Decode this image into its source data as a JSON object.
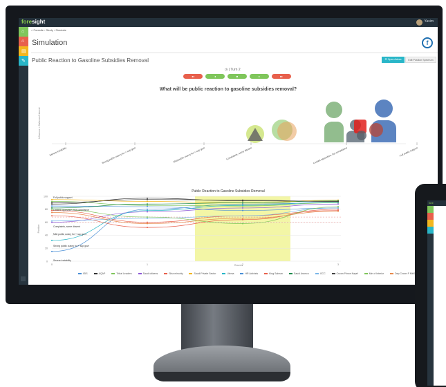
{
  "app": {
    "brand_a": "fore",
    "brand_b": "sight",
    "user_name": "Yasim"
  },
  "breadcrumb": "⌂  Foresite  ›  Study  ›  Simulate",
  "page_title": "Simulation",
  "logo_letter": "f",
  "subtitle": "Public Reaction to Gasoline Subsidies Removal",
  "buttons": {
    "open_actors": "☰ Open Actors",
    "edit_spectrum": "Edit Position Spectrum"
  },
  "turn_label": "◷ | Turn 2",
  "turn_buttons": [
    {
      "label": "◂◂",
      "color": "#e8604c"
    },
    {
      "label": "◂",
      "color": "#7fc65b"
    },
    {
      "label": "■",
      "color": "#7fc65b"
    },
    {
      "label": "▸",
      "color": "#7fc65b"
    },
    {
      "label": "▸▸",
      "color": "#e8604c"
    }
  ],
  "question": "What will be public reaction to gasoline subsidies removal?",
  "spectrum_axis_label": "Influence × Salience/Interest",
  "spectrum_categories": [
    "Severe instability",
    "Strong public outcry for + sup govt",
    "Mild public outcry for + sup govt",
    "Complaints, some dissent",
    "Limited opposition, but compliance",
    "Full public support"
  ],
  "line_chart": {
    "title": "Public Reaction to Gasoline Subsidies Removal",
    "xlabel": "Rounds",
    "ylabel": "Position",
    "level_labels": [
      "Full public support",
      "Limited opposition, but compliance",
      "Complaints, some dissent",
      "Mild public outcry for + sup govt",
      "Strong public outcry for + sup govt",
      "Severe instability"
    ]
  },
  "side_icons": [
    {
      "name": "home-icon",
      "glyph": "⌂",
      "color": "#7fc65b"
    },
    {
      "name": "dashboard-icon",
      "glyph": "⌂",
      "color": "#e8604c"
    },
    {
      "name": "folder-icon",
      "glyph": "▤",
      "color": "#f3b61f"
    },
    {
      "name": "pencil-icon",
      "glyph": "✎",
      "color": "#29b6c8"
    }
  ],
  "chart_data": [
    {
      "type": "scatter",
      "title": "What will be public reaction to gasoline subsidies removal?",
      "ylabel": "Influence × Salience/Interest",
      "categories": [
        "Severe instability",
        "Strong public outcry for + sup govt",
        "Mild public outcry for + sup govt",
        "Complaints, some dissent",
        "Limited opposition, but compliance",
        "Full public support"
      ],
      "x_ticks": [
        0,
        20,
        40,
        60,
        80,
        100
      ],
      "visible_tick_labels": [
        "0",
        "10",
        "30",
        "50",
        "70",
        "80",
        "100"
      ]
    },
    {
      "type": "line",
      "title": "Public Reaction to Gasoline Subsidies Removal",
      "xlabel": "Rounds",
      "ylabel": "Position",
      "x": [
        0,
        1,
        2,
        3
      ],
      "ylim": [
        0,
        100
      ],
      "y_ticks": [
        0,
        20,
        40,
        60,
        80,
        100
      ],
      "highlight_x_range": [
        1.5,
        2.5
      ],
      "series": [
        {
          "name": "ISIS",
          "color": "#4a8fd6",
          "values": [
            15,
            80,
            88,
            90
          ]
        },
        {
          "name": "AQAP",
          "color": "#333333",
          "values": [
            88,
            97,
            93,
            92
          ]
        },
        {
          "name": "Tribal Leaders",
          "color": "#7fc65b",
          "values": [
            92,
            86,
            85,
            90
          ]
        },
        {
          "name": "Saudi citizens",
          "color": "#8e5ad6",
          "values": [
            60,
            76,
            82,
            88
          ]
        },
        {
          "name": "Shia minority",
          "color": "#e8604c",
          "values": [
            70,
            52,
            64,
            80
          ]
        },
        {
          "name": "Saudi Private Sector",
          "color": "#f3b61f",
          "values": [
            95,
            92,
            90,
            94
          ]
        },
        {
          "name": "Ulema",
          "color": "#29b6c8",
          "values": [
            32,
            78,
            86,
            91
          ]
        },
        {
          "name": "HR Activists",
          "color": "#4a8fd6",
          "values": [
            85,
            84,
            78,
            82
          ]
        },
        {
          "name": "King Salman",
          "color": "#e8604c",
          "values": [
            78,
            60,
            70,
            78
          ]
        },
        {
          "name": "Saudi Aramco",
          "color": "#1f8a4c",
          "values": [
            82,
            88,
            90,
            93
          ]
        },
        {
          "name": "GCC",
          "color": "#7ab6e8",
          "values": [
            62,
            66,
            70,
            82
          ]
        },
        {
          "name": "Crown Prince Nayef",
          "color": "#444444",
          "values": [
            90,
            95,
            94,
            92
          ]
        },
        {
          "name": "Min of Interior",
          "color": "#7fc65b",
          "values": [
            80,
            68,
            58,
            84
          ]
        },
        {
          "name": "Dep Crown P MbS",
          "color": "#e88a4c",
          "values": [
            75,
            58,
            66,
            77
          ]
        }
      ]
    }
  ]
}
